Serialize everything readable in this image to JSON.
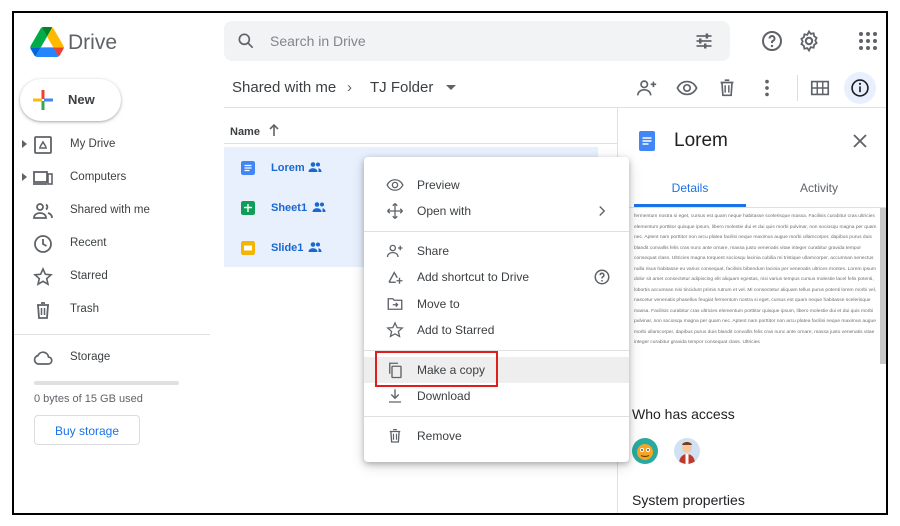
{
  "app": {
    "title": "Drive"
  },
  "search": {
    "placeholder": "Search in Drive"
  },
  "sidebar": {
    "new_label": "New",
    "items": [
      {
        "label": "My Drive"
      },
      {
        "label": "Computers"
      },
      {
        "label": "Shared with me"
      },
      {
        "label": "Recent"
      },
      {
        "label": "Starred"
      },
      {
        "label": "Trash"
      }
    ],
    "storage_label": "Storage",
    "storage_used": "0 bytes of 15 GB used",
    "buy_storage": "Buy storage"
  },
  "breadcrumb": {
    "parent": "Shared with me",
    "separator": "›",
    "current": "TJ Folder"
  },
  "file_list": {
    "column_name": "Name",
    "files": [
      {
        "name": "Lorem",
        "type": "doc"
      },
      {
        "name": "Sheet1",
        "type": "sheet"
      },
      {
        "name": "Slide1",
        "type": "slide"
      }
    ]
  },
  "context_menu": {
    "items": [
      {
        "label": "Preview"
      },
      {
        "label": "Open with"
      },
      {
        "label": "Share"
      },
      {
        "label": "Add shortcut to Drive"
      },
      {
        "label": "Move to"
      },
      {
        "label": "Add to Starred"
      },
      {
        "label": "Make a copy"
      },
      {
        "label": "Download"
      },
      {
        "label": "Remove"
      }
    ]
  },
  "details": {
    "title": "Lorem",
    "tabs": [
      {
        "label": "Details"
      },
      {
        "label": "Activity"
      }
    ],
    "preview_text": "fermentum nostra si eget, cursus est quam neque habitasse scelerisque massa. Facilisis curabitur cras ultricies elementum porttitor quisque ipsum, libero molestie dui et dui quis morbi pulvinar, non sociosqu magna per quam nec. Aptent nam porttitor non arcu platea facilisi neque maximus augue morbi ullamcorper, dapibus purus duis blandit convallis felis cras nunc ante ornare, massa justo venenatis vitae integer curabitur gravida tempor consequat class. Ultricies magna torquent sociosqu lacinia cubilia mi tristique ullamcorper, accumsan senectus nulla risus habitasse eu varius consequat, facilisis bibendum lacinia per venenatis ultrices montes. Lorem ipsum dolor sit amet consectetur adipiscing elit aliquam egestas, nisi varius tempus cursus molestie lacel felis potenti, lobortis accumsan nisi tincidunt primis rutrum et vel. Mi consectetur aliquam tellus purus potenti lorem morbi vel, nascetur venenatis phasellus feugiat fermentum nostra si eget, cursus est quam neque habitasse scelerisque massa. Facilisis curabitur cras ultricies elementum porttitor quisque ipsum, libero molestie dui et dui quis morbi pulvinar, non sociosqu magna per quam nec. Aptent nam porttitor non arcu platea facilisi neque maximus augue morbi ullamcorper, dapibus purus duis blandit convallis felis cras nunc ante ornare, massa justo venenatis vitae integer curabitur gravida tempor consequat class. Ultricies",
    "who_has_access": "Who has access",
    "system_properties": "System properties"
  },
  "colors": {
    "accent": "#1a73e8",
    "selection": "#e8f0fe",
    "highlight_box": "#e01e1e",
    "doc": "#4285f4",
    "sheet": "#0f9d58",
    "slide": "#f4b400"
  }
}
